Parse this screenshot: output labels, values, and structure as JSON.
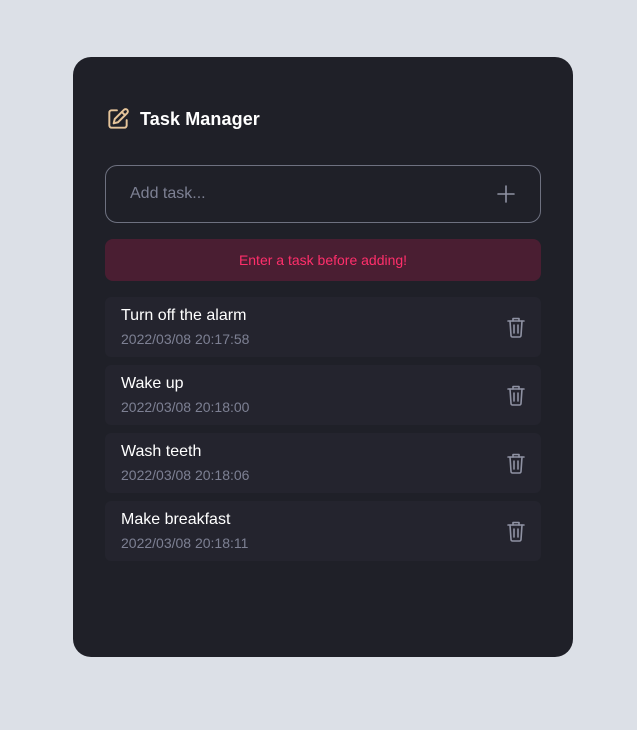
{
  "header": {
    "title": "Task Manager",
    "icon": "edit-icon",
    "icon_color": "#e5c49a"
  },
  "input": {
    "placeholder": "Add task...",
    "value": "",
    "add_icon": "plus-icon"
  },
  "error": {
    "message": "Enter a task before adding!",
    "text_color": "#ff2f6b",
    "background": "#4a1e32"
  },
  "tasks": [
    {
      "text": "Turn off the alarm",
      "time": "2022/03/08 20:17:58",
      "icon": "trash-icon"
    },
    {
      "text": "Wake up",
      "time": "2022/03/08 20:18:00",
      "icon": "trash-icon"
    },
    {
      "text": "Wash teeth",
      "time": "2022/03/08 20:18:06",
      "icon": "trash-icon"
    },
    {
      "text": "Make breakfast",
      "time": "2022/03/08 20:18:11",
      "icon": "trash-icon"
    }
  ],
  "colors": {
    "page_background": "#dce0e7",
    "card_background": "#1f2028",
    "task_background": "#24242e",
    "muted_text": "#7d8093"
  }
}
